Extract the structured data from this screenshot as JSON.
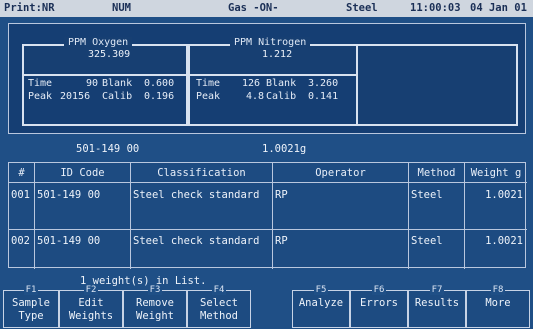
{
  "status_bar": {
    "print": "Print:NR",
    "num": "NUM",
    "gas": "Gas -ON-",
    "method": "Steel",
    "time": "11:00:03",
    "date": "04 Jan 01"
  },
  "oxygen": {
    "title": "PPM  Oxygen",
    "value": "325.309",
    "time_label": "Time",
    "time_value": "90",
    "blank_label": "Blank",
    "blank_value": "0.600",
    "peak_label": "Peak",
    "peak_value": "20156",
    "calib_label": "Calib",
    "calib_value": "0.196"
  },
  "nitrogen": {
    "title": "PPM  Nitrogen",
    "value": "1.212",
    "time_label": "Time",
    "time_value": "126",
    "blank_label": "Blank",
    "blank_value": "3.260",
    "peak_label": "Peak",
    "peak_value": "4.8",
    "calib_label": "Calib",
    "calib_value": "0.141"
  },
  "sample": {
    "id": "501-149 00",
    "weight": "1.0021g"
  },
  "table": {
    "headers": [
      "#",
      "ID Code",
      "Classification",
      "Operator",
      "Method",
      "Weight g"
    ],
    "rows": [
      [
        "001",
        "501-149 00",
        "Steel check standard",
        "RP",
        "Steel",
        "1.0021"
      ],
      [
        "002",
        "501-149 00",
        "Steel check standard",
        "RP",
        "Steel",
        "1.0021"
      ]
    ]
  },
  "count_text": "1 weight(s) in List.",
  "function_keys": [
    {
      "key": "F1",
      "line1": "Sample",
      "line2": "Type"
    },
    {
      "key": "F2",
      "line1": "Edit",
      "line2": "Weights"
    },
    {
      "key": "F3",
      "line1": "Remove",
      "line2": "Weight"
    },
    {
      "key": "F4",
      "line1": "Select",
      "line2": "Method"
    },
    {
      "key": "F5",
      "line1": "Analyze",
      "line2": ""
    },
    {
      "key": "F6",
      "line1": "Errors",
      "line2": ""
    },
    {
      "key": "F7",
      "line1": "Results",
      "line2": ""
    },
    {
      "key": "F8",
      "line1": "More",
      "line2": ""
    }
  ]
}
